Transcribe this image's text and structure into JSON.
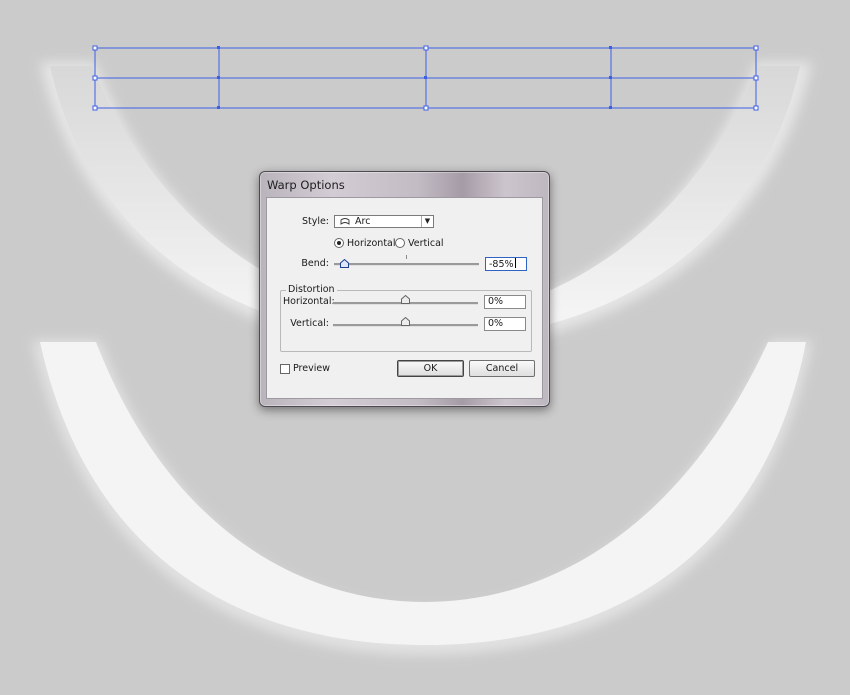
{
  "dialog": {
    "title": "Warp Options",
    "style_label": "Style:",
    "style_value": "Arc",
    "style_icon": "arc-icon",
    "orientation": {
      "horizontal_label": "Horizontal",
      "vertical_label": "Vertical",
      "selected": "Horizontal"
    },
    "bend_label": "Bend:",
    "bend_value": "-85%",
    "bend_level": -0.85,
    "distortion": {
      "legend": "Distortion",
      "horizontal_label": "Horizontal:",
      "horizontal_value": "0%",
      "horizontal_level": 0,
      "vertical_label": "Vertical:",
      "vertical_value": "0%",
      "vertical_level": 0
    },
    "preview_label": "Preview",
    "preview_checked": false,
    "ok_label": "OK",
    "cancel_label": "Cancel"
  },
  "colors": {
    "canvas_background": "#cbcbcb",
    "selection_outline": "#3c5fe6",
    "arc_fill": "#f4f4f4"
  }
}
